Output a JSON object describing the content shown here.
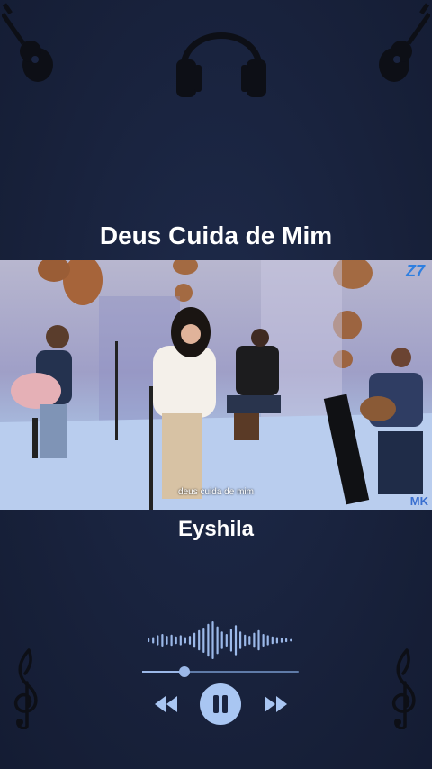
{
  "player": {
    "song_title": "Deus Cuida de Mim",
    "artist": "Eyshila",
    "progress_fraction": 0.27
  },
  "video": {
    "subtitle": "deus cuida de mim",
    "channel_logo": "Z7",
    "watermark": "MK"
  },
  "icons": {
    "top_left": "acoustic-guitar-icon",
    "top_center": "headphones-icon",
    "top_right": "acoustic-guitar-icon",
    "bottom_left": "treble-clef-icon",
    "bottom_right": "treble-clef-icon",
    "controls": [
      "rewind-icon",
      "pause-icon",
      "fast-forward-icon"
    ]
  },
  "colors": {
    "background": "#1a2440",
    "accent": "#a9c6f2",
    "icon": "#0d0f16"
  }
}
